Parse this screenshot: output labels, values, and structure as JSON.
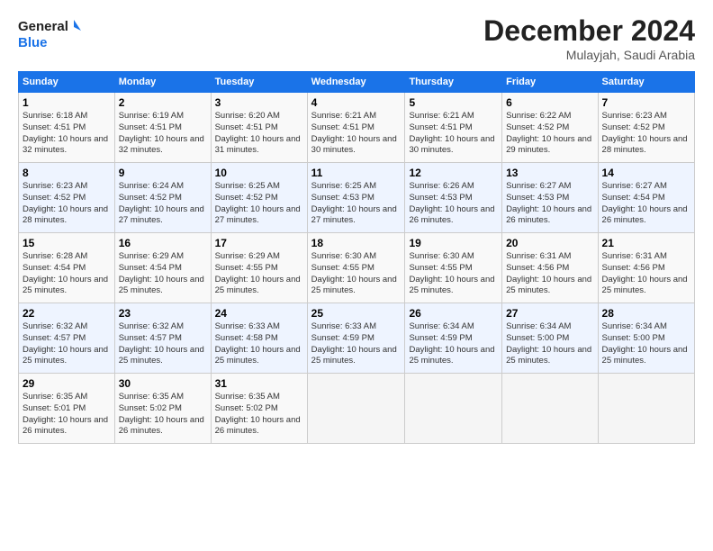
{
  "logo": {
    "line1": "General",
    "line2": "Blue"
  },
  "header": {
    "month": "December 2024",
    "location": "Mulayjah, Saudi Arabia"
  },
  "weekdays": [
    "Sunday",
    "Monday",
    "Tuesday",
    "Wednesday",
    "Thursday",
    "Friday",
    "Saturday"
  ],
  "weeks": [
    [
      {
        "day": "1",
        "sunrise": "6:18 AM",
        "sunset": "4:51 PM",
        "daylight": "10 hours and 32 minutes."
      },
      {
        "day": "2",
        "sunrise": "6:19 AM",
        "sunset": "4:51 PM",
        "daylight": "10 hours and 32 minutes."
      },
      {
        "day": "3",
        "sunrise": "6:20 AM",
        "sunset": "4:51 PM",
        "daylight": "10 hours and 31 minutes."
      },
      {
        "day": "4",
        "sunrise": "6:21 AM",
        "sunset": "4:51 PM",
        "daylight": "10 hours and 30 minutes."
      },
      {
        "day": "5",
        "sunrise": "6:21 AM",
        "sunset": "4:51 PM",
        "daylight": "10 hours and 30 minutes."
      },
      {
        "day": "6",
        "sunrise": "6:22 AM",
        "sunset": "4:52 PM",
        "daylight": "10 hours and 29 minutes."
      },
      {
        "day": "7",
        "sunrise": "6:23 AM",
        "sunset": "4:52 PM",
        "daylight": "10 hours and 28 minutes."
      }
    ],
    [
      {
        "day": "8",
        "sunrise": "6:23 AM",
        "sunset": "4:52 PM",
        "daylight": "10 hours and 28 minutes."
      },
      {
        "day": "9",
        "sunrise": "6:24 AM",
        "sunset": "4:52 PM",
        "daylight": "10 hours and 27 minutes."
      },
      {
        "day": "10",
        "sunrise": "6:25 AM",
        "sunset": "4:52 PM",
        "daylight": "10 hours and 27 minutes."
      },
      {
        "day": "11",
        "sunrise": "6:25 AM",
        "sunset": "4:53 PM",
        "daylight": "10 hours and 27 minutes."
      },
      {
        "day": "12",
        "sunrise": "6:26 AM",
        "sunset": "4:53 PM",
        "daylight": "10 hours and 26 minutes."
      },
      {
        "day": "13",
        "sunrise": "6:27 AM",
        "sunset": "4:53 PM",
        "daylight": "10 hours and 26 minutes."
      },
      {
        "day": "14",
        "sunrise": "6:27 AM",
        "sunset": "4:54 PM",
        "daylight": "10 hours and 26 minutes."
      }
    ],
    [
      {
        "day": "15",
        "sunrise": "6:28 AM",
        "sunset": "4:54 PM",
        "daylight": "10 hours and 25 minutes."
      },
      {
        "day": "16",
        "sunrise": "6:29 AM",
        "sunset": "4:54 PM",
        "daylight": "10 hours and 25 minutes."
      },
      {
        "day": "17",
        "sunrise": "6:29 AM",
        "sunset": "4:55 PM",
        "daylight": "10 hours and 25 minutes."
      },
      {
        "day": "18",
        "sunrise": "6:30 AM",
        "sunset": "4:55 PM",
        "daylight": "10 hours and 25 minutes."
      },
      {
        "day": "19",
        "sunrise": "6:30 AM",
        "sunset": "4:55 PM",
        "daylight": "10 hours and 25 minutes."
      },
      {
        "day": "20",
        "sunrise": "6:31 AM",
        "sunset": "4:56 PM",
        "daylight": "10 hours and 25 minutes."
      },
      {
        "day": "21",
        "sunrise": "6:31 AM",
        "sunset": "4:56 PM",
        "daylight": "10 hours and 25 minutes."
      }
    ],
    [
      {
        "day": "22",
        "sunrise": "6:32 AM",
        "sunset": "4:57 PM",
        "daylight": "10 hours and 25 minutes."
      },
      {
        "day": "23",
        "sunrise": "6:32 AM",
        "sunset": "4:57 PM",
        "daylight": "10 hours and 25 minutes."
      },
      {
        "day": "24",
        "sunrise": "6:33 AM",
        "sunset": "4:58 PM",
        "daylight": "10 hours and 25 minutes."
      },
      {
        "day": "25",
        "sunrise": "6:33 AM",
        "sunset": "4:59 PM",
        "daylight": "10 hours and 25 minutes."
      },
      {
        "day": "26",
        "sunrise": "6:34 AM",
        "sunset": "4:59 PM",
        "daylight": "10 hours and 25 minutes."
      },
      {
        "day": "27",
        "sunrise": "6:34 AM",
        "sunset": "5:00 PM",
        "daylight": "10 hours and 25 minutes."
      },
      {
        "day": "28",
        "sunrise": "6:34 AM",
        "sunset": "5:00 PM",
        "daylight": "10 hours and 25 minutes."
      }
    ],
    [
      {
        "day": "29",
        "sunrise": "6:35 AM",
        "sunset": "5:01 PM",
        "daylight": "10 hours and 26 minutes."
      },
      {
        "day": "30",
        "sunrise": "6:35 AM",
        "sunset": "5:02 PM",
        "daylight": "10 hours and 26 minutes."
      },
      {
        "day": "31",
        "sunrise": "6:35 AM",
        "sunset": "5:02 PM",
        "daylight": "10 hours and 26 minutes."
      },
      null,
      null,
      null,
      null
    ]
  ]
}
